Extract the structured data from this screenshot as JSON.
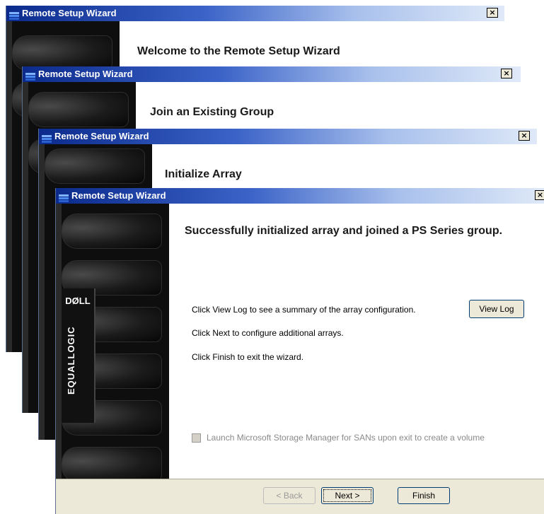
{
  "windows": [
    {
      "title": "Remote Setup Wizard",
      "heading": "Welcome to the Remote Setup Wizard",
      "close_glyph": "×"
    },
    {
      "title": "Remote Setup Wizard",
      "heading": "Join an Existing Group",
      "close_glyph": "×"
    },
    {
      "title": "Remote Setup Wizard",
      "heading": "Initialize Array",
      "close_glyph": "×"
    },
    {
      "title": "Remote Setup Wizard",
      "heading": "Successfully initialized array and joined a PS Series group.",
      "close_glyph": "×"
    }
  ],
  "sidebar": {
    "brand_dell": "DØLL",
    "brand_equallogic": "EQUALLOGIC"
  },
  "body": {
    "line_view_log": "Click View Log to see a summary of the array configuration.",
    "line_next": "Click Next to configure additional arrays.",
    "line_finish": "Click Finish to exit the wizard.",
    "view_log_button": "View Log",
    "checkbox_label": "Launch Microsoft Storage Manager for SANs upon exit to create a volume",
    "checkbox_checked": false,
    "checkbox_enabled": false
  },
  "footer": {
    "back": "< Back",
    "next": "Next >",
    "finish": "Finish"
  },
  "colors": {
    "titlebar_start": "#0b2a8c",
    "dialog_face": "#ece9d8"
  }
}
